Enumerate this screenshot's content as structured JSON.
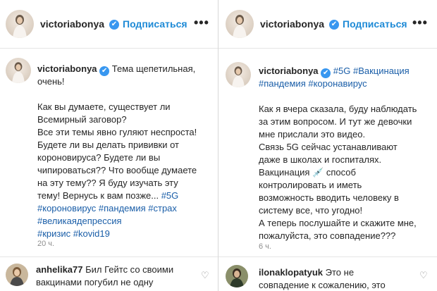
{
  "left": {
    "header": {
      "username": "victoriabonya",
      "verified_icon": "✔",
      "follow_label": "Подписаться",
      "more_label": "•••"
    },
    "post": {
      "username": "victoriabonya",
      "title_line1_suffix": " Тема щепетильная,",
      "title_line2": "очень!",
      "body_lines": [
        "Как вы думаете, существует ли",
        "Всемирный заговор?",
        "Все эти темы явно гуляют неспроста!",
        "Будете ли вы делать прививки от",
        "короновируса? Будете ли вы",
        "чипироваться?? Что вообще думаете",
        "на эту тему?? Я буду изучать эту"
      ],
      "line_prefix": "тему! Вернусь к вам позже... ",
      "hashtags": [
        "#5G",
        "#короновирус",
        "#пандемия",
        "#страх",
        "#великаядепрессия",
        "#кризис",
        "#kovid19"
      ],
      "time": "20 ч."
    },
    "comment": {
      "username": "anhelika77",
      "line1": " Бил Гейтс со своими",
      "line2": "вакцинами погубил не одну"
    }
  },
  "right": {
    "header": {
      "username": "victoriabonya",
      "verified_icon": "✔",
      "follow_label": "Подписаться",
      "more_label": "•••"
    },
    "post": {
      "username": "victoriabonya",
      "hashtags": [
        "#5G",
        "#Вакцинация",
        "#пандемия",
        "#коронавирус"
      ],
      "body_lines": [
        "Как я вчера сказала, буду наблюдать",
        "за этим вопросом. И тут же девочки",
        "мне прислали это видео.",
        "Связь 5G сейчас устанавливают",
        "даже в школах и госпиталях."
      ],
      "vacc_word": "Вакцинация ",
      "syringe_emoji": "💉",
      "vacc_rest": " способ",
      "body_lines2": [
        "контролировать и иметь",
        "возможность вводить человеку в",
        "систему все, что угодно!",
        "А теперь послушайте и скажите мне,",
        "пожалуйста, это совпадение???"
      ],
      "time": "6 ч."
    },
    "comment": {
      "username": "ilonaklopatyuk",
      "line1": " Это не",
      "line2": "совпадение к сожалению, это"
    }
  },
  "icons": {
    "heart": "♡"
  },
  "colors": {
    "link_blue": "#1e8ad6",
    "hashtag_blue": "#1a5ea8",
    "verified_blue": "#3897f0",
    "text": "#262626",
    "muted": "#8e8e8e"
  }
}
